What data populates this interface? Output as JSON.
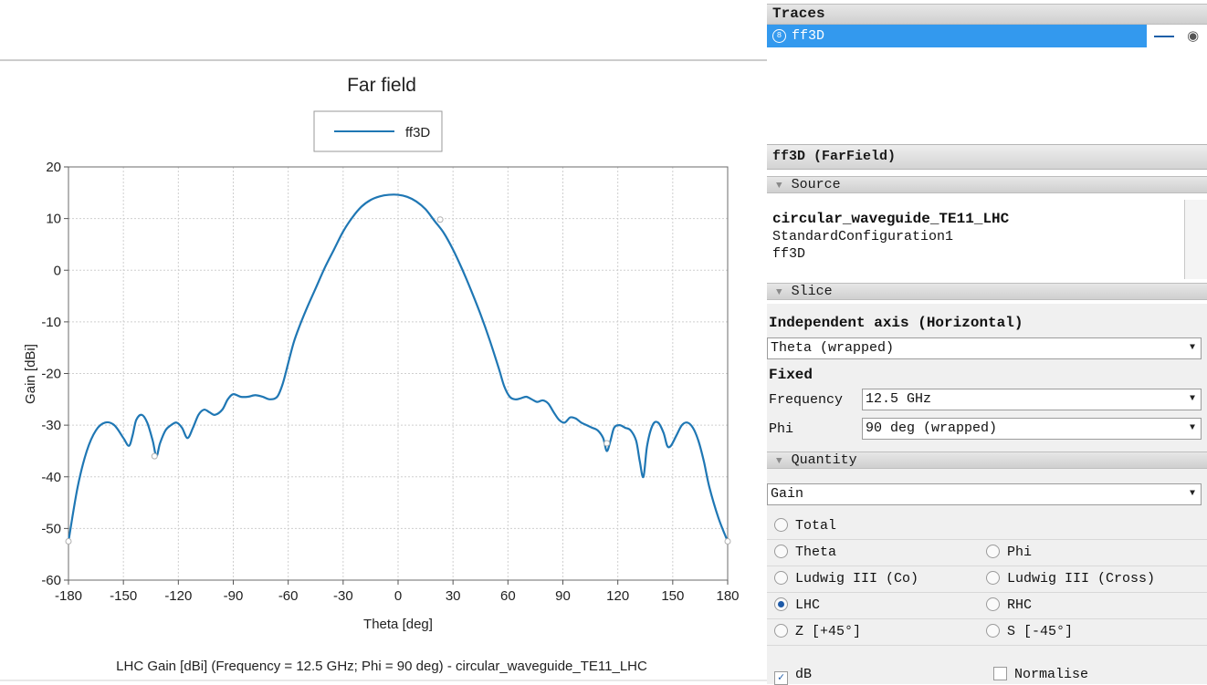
{
  "chart_data": {
    "type": "line",
    "title": "Far field",
    "xlabel": "Theta [deg]",
    "ylabel": "Gain [dBi]",
    "caption": "LHC Gain [dBi] (Frequency = 12.5 GHz; Phi = 90 deg) - circular_waveguide_TE11_LHC",
    "xlim": [
      -180,
      180
    ],
    "ylim": [
      -60,
      20
    ],
    "xticks": [
      -180,
      -150,
      -120,
      -90,
      -60,
      -30,
      0,
      30,
      60,
      90,
      120,
      150,
      180
    ],
    "yticks": [
      20,
      10,
      0,
      -10,
      -20,
      -30,
      -40,
      -50,
      -60
    ],
    "grid": true,
    "legend_position": "top-center",
    "series": [
      {
        "name": "ff3D",
        "color": "#1f77b4",
        "x": [
          -180,
          -175,
          -170,
          -165,
          -160,
          -155,
          -150,
          -147,
          -145,
          -143,
          -140,
          -137,
          -134,
          -132,
          -130,
          -127,
          -124,
          -121,
          -118,
          -115,
          -112,
          -109,
          -106,
          -103,
          -100,
          -96,
          -93,
          -90,
          -86,
          -82,
          -78,
          -74,
          -70,
          -66,
          -63,
          -60,
          -57,
          -54,
          -50,
          -45,
          -40,
          -35,
          -30,
          -25,
          -20,
          -15,
          -10,
          -5,
          0,
          5,
          10,
          15,
          20,
          25,
          30,
          35,
          40,
          45,
          50,
          55,
          58,
          61,
          64,
          67,
          70,
          73,
          76,
          79,
          82,
          85,
          88,
          91,
          94,
          97,
          100,
          103,
          106,
          109,
          112,
          114,
          116,
          118,
          121,
          124,
          127,
          130,
          132,
          134,
          136,
          139,
          142,
          145,
          147,
          149,
          152,
          155,
          158,
          161,
          164,
          167,
          170,
          175,
          180
        ],
        "y": [
          -52.5,
          -42,
          -35,
          -31,
          -29.5,
          -30,
          -32.5,
          -34,
          -32,
          -29,
          -28,
          -29.5,
          -33,
          -36,
          -33.5,
          -31,
          -30,
          -29.5,
          -30.5,
          -32.5,
          -30.5,
          -28,
          -27,
          -27.5,
          -28,
          -27,
          -25,
          -24,
          -24.5,
          -24.5,
          -24.2,
          -24.5,
          -25,
          -24.5,
          -22,
          -18,
          -14,
          -11,
          -7.5,
          -3.5,
          0.5,
          4,
          7.5,
          10.2,
          12.3,
          13.6,
          14.3,
          14.6,
          14.6,
          14.2,
          13.3,
          11.8,
          9.5,
          7.2,
          4,
          0.2,
          -4,
          -8.5,
          -13.5,
          -19,
          -22.5,
          -24.5,
          -25,
          -24.8,
          -24.5,
          -25,
          -25.5,
          -25.2,
          -25.8,
          -27.5,
          -29,
          -29.5,
          -28.5,
          -28.7,
          -29.5,
          -30,
          -30.5,
          -31,
          -32.5,
          -35,
          -33,
          -30.5,
          -30,
          -30.5,
          -31,
          -33,
          -37,
          -40,
          -34,
          -30,
          -29.5,
          -31.5,
          -34,
          -34,
          -32,
          -30,
          -29.5,
          -30.5,
          -33,
          -37,
          -42,
          -48,
          -52.5
        ]
      }
    ],
    "markers": [
      {
        "x": -180,
        "y": -52.5
      },
      {
        "x": -133,
        "y": -36
      },
      {
        "x": 23,
        "y": 9.8
      },
      {
        "x": 114,
        "y": -33.5
      },
      {
        "x": 180,
        "y": -52.5
      }
    ]
  },
  "traces": {
    "header": "Traces",
    "items": [
      {
        "number": "8",
        "label": "ff3D"
      }
    ]
  },
  "properties": {
    "header": "ff3D (FarField)",
    "source": {
      "label": "Source",
      "lines": [
        "circular_waveguide_TE11_LHC",
        "StandardConfiguration1",
        "ff3D"
      ]
    },
    "slice": {
      "label": "Slice",
      "independent_axis_label": "Independent axis (Horizontal)",
      "independent_axis_value": "Theta (wrapped)",
      "fixed_label": "Fixed",
      "frequency_label": "Frequency",
      "frequency_value": "12.5 GHz",
      "phi_label": "Phi",
      "phi_value": "90 deg (wrapped)"
    },
    "quantity": {
      "label": "Quantity",
      "value": "Gain",
      "options": {
        "total": "Total",
        "theta": "Theta",
        "phi": "Phi",
        "ludwig_co": "Ludwig III (Co)",
        "ludwig_cross": "Ludwig III (Cross)",
        "lhc": "LHC",
        "rhc": "RHC",
        "z": "Z [+45°]",
        "s": "S [-45°]"
      },
      "selected": "LHC",
      "db_label": "dB",
      "db_checked": true,
      "normalise_label": "Normalise",
      "normalise_checked": false
    }
  }
}
